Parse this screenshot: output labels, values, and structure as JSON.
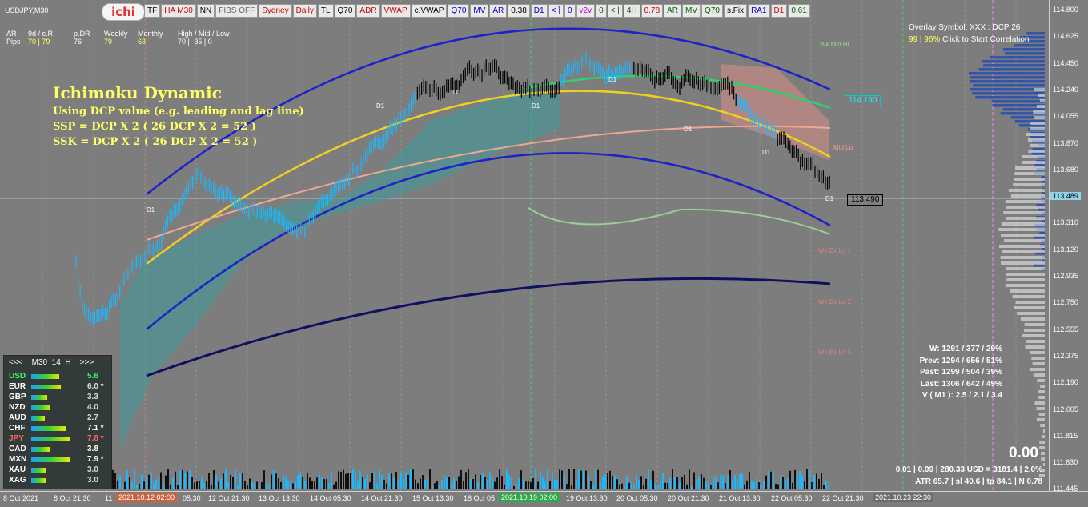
{
  "symbol_label": "USDJPY,M30",
  "logo_text": "ichi",
  "toolbar": [
    {
      "label": "TF",
      "color": "#000000"
    },
    {
      "label": "HA M30",
      "color": "#cc0000"
    },
    {
      "label": "NN",
      "color": "#000000"
    },
    {
      "label": "FIBS OFF",
      "color": "#666666"
    },
    {
      "label": "Sydney",
      "color": "#cc0000"
    },
    {
      "label": "Daily",
      "color": "#cc0000"
    },
    {
      "label": "TL",
      "color": "#000000"
    },
    {
      "label": "Q70",
      "color": "#000000"
    },
    {
      "label": "ADR",
      "color": "#cc0000"
    },
    {
      "label": "VWAP",
      "color": "#cc0000"
    },
    {
      "label": "c.VWAP",
      "color": "#000000"
    },
    {
      "label": "Q70",
      "color": "#0000cc"
    },
    {
      "label": "MV",
      "color": "#0000cc"
    },
    {
      "label": "AR",
      "color": "#0000cc"
    },
    {
      "label": "0.38",
      "color": "#000000"
    },
    {
      "label": "D1",
      "color": "#0000cc"
    },
    {
      "label": "< ]",
      "color": "#0000cc"
    },
    {
      "label": "0",
      "color": "#0000cc"
    },
    {
      "label": "v2v",
      "color": "#cc00cc"
    },
    {
      "label": "0",
      "color": "#006600"
    },
    {
      "label": "< |",
      "color": "#006600"
    },
    {
      "label": "4H",
      "color": "#006600"
    },
    {
      "label": "0.78",
      "color": "#cc0000"
    },
    {
      "label": "AR",
      "color": "#006600"
    },
    {
      "label": "MV",
      "color": "#006600"
    },
    {
      "label": "Q70",
      "color": "#006600"
    },
    {
      "label": "s.Fix",
      "color": "#000000"
    },
    {
      "label": "RA1",
      "color": "#0000cc"
    },
    {
      "label": "D1",
      "color": "#cc0000"
    },
    {
      "label": "0.61",
      "color": "#006600"
    }
  ],
  "info_table": {
    "row1": [
      "AR",
      "9d / c.R",
      "p.DR",
      "Weekly",
      "Monthly",
      "High / Mid / Low"
    ],
    "row2": [
      "Pips",
      "70 | 79",
      "76",
      "79",
      "63",
      "70  |  -35  |  0"
    ]
  },
  "title": "Ichimoku Dynamic",
  "desc": [
    "Using DCP value (e.g. leading and lag line)",
    "SSP = DCP X 2  ( 26 DCP  X 2 = 52 )",
    "SSK = DCP X 2  ( 26 DCP  X 2 = 52 )"
  ],
  "overlay": {
    "line1": "Overlay Symbol: XXX : DCP 26",
    "line2_pct": "99 | 96%",
    "line2_text": " Click to Start Correlation"
  },
  "line_labels": [
    {
      "text": "Wk Mid Hi",
      "color": "#9ad79a"
    },
    {
      "text": "Mid Lo",
      "color": "#f0a090"
    },
    {
      "text": "Wk Ex Lo 1",
      "color": "#e08080"
    },
    {
      "text": "Wk Ex Lo 2",
      "color": "#e08080"
    },
    {
      "text": "Wk Ex Lo 3",
      "color": "#e08080"
    }
  ],
  "d1_labels": [
    "D1",
    "D1",
    "D1",
    "D1",
    "D1",
    "D1",
    "D1",
    "D1"
  ],
  "price_boxes": {
    "p1": "114.190",
    "p2": "113.490",
    "current": "113.489"
  },
  "stats": [
    "W: 1291 / 377 / 29%",
    "Prev: 1294 / 656 / 51%",
    "Past: 1299 / 504 / 39%",
    "Last: 1306 / 642 / 49%",
    "V ( M1 ): 2.5 / 2.1 / 3.4"
  ],
  "big_value": "0.00",
  "bottom1": "0.01  |  0.09  |  280.33 USD = 3181.4  |  2.0%",
  "bottom2": "ATR 65.7  | sl 40.6  | tp 84.1  | N 0.78",
  "meter": {
    "header": "<<<    M30  14  H    >>>",
    "rows": [
      {
        "cur": "USD",
        "val": "5.6",
        "color": "#33ff66",
        "valcolor": "#33ff66"
      },
      {
        "cur": "EUR",
        "val": "6.0 *",
        "color": "#ffffff",
        "valcolor": "#dddddd"
      },
      {
        "cur": "GBP",
        "val": "3.3",
        "color": "#ffffff",
        "valcolor": "#dddddd"
      },
      {
        "cur": "NZD",
        "val": "4.0",
        "color": "#ffffff",
        "valcolor": "#dddddd"
      },
      {
        "cur": "AUD",
        "val": "2.7",
        "color": "#ffffff",
        "valcolor": "#dddddd"
      },
      {
        "cur": "CHF",
        "val": "7.1 *",
        "color": "#ffffff",
        "valcolor": "#ffffff"
      },
      {
        "cur": "JPY",
        "val": "7.8 *",
        "color": "#ff6666",
        "valcolor": "#ff6666"
      },
      {
        "cur": "CAD",
        "val": "3.8",
        "color": "#ffffff",
        "valcolor": "#ffffff"
      },
      {
        "cur": "MXN",
        "val": "7.9 *",
        "color": "#ffffff",
        "valcolor": "#ffffff"
      },
      {
        "cur": "XAU",
        "val": "3.0",
        "color": "#ffffff",
        "valcolor": "#dddddd"
      },
      {
        "cur": "XAG",
        "val": "3.0",
        "color": "#ffffff",
        "valcolor": "#dddddd"
      }
    ],
    "levels": [
      0.72,
      0.78,
      0.42,
      0.5,
      0.35,
      0.9,
      1.0,
      0.48,
      1.0,
      0.38,
      0.38
    ]
  },
  "price_axis": [
    "114.800",
    "114.625",
    "114.450",
    "114.240",
    "114.055",
    "113.870",
    "113.680",
    "113.489",
    "113.310",
    "113.120",
    "112.935",
    "112.750",
    "112.555",
    "112.375",
    "112.190",
    "112.005",
    "111.815",
    "111.630",
    "111.445"
  ],
  "time_axis": [
    {
      "text": "8 Oct 2021",
      "box": false
    },
    {
      "text": "8 Oct 21:30",
      "box": false
    },
    {
      "text": "11",
      "box": false
    },
    {
      "text": "2021.10.12 02:00",
      "box": true,
      "bg": "#c8643c"
    },
    {
      "text": "05:30",
      "box": false
    },
    {
      "text": "12 Oct 21:30",
      "box": false
    },
    {
      "text": "13 Oct 13:30",
      "box": false
    },
    {
      "text": "14 Oct 05:30",
      "box": false
    },
    {
      "text": "14 Oct 21:30",
      "box": false
    },
    {
      "text": "15 Oct 13:30",
      "box": false
    },
    {
      "text": "18 Oct 05",
      "box": false
    },
    {
      "text": "2021.10.19 02:00",
      "box": true,
      "bg": "#2fa84f"
    },
    {
      "text": "19 Oct 13:30",
      "box": false
    },
    {
      "text": "20 Oct 05:30",
      "box": false
    },
    {
      "text": "20 Oct 21:30",
      "box": false
    },
    {
      "text": "21 Oct 13:30",
      "box": false
    },
    {
      "text": "22 Oct 05:30",
      "box": false
    },
    {
      "text": "22 Oct 21:30",
      "box": false
    },
    {
      "text": "2021.10.23 22:30",
      "box": true,
      "bg": "#6c6c6c"
    }
  ]
}
